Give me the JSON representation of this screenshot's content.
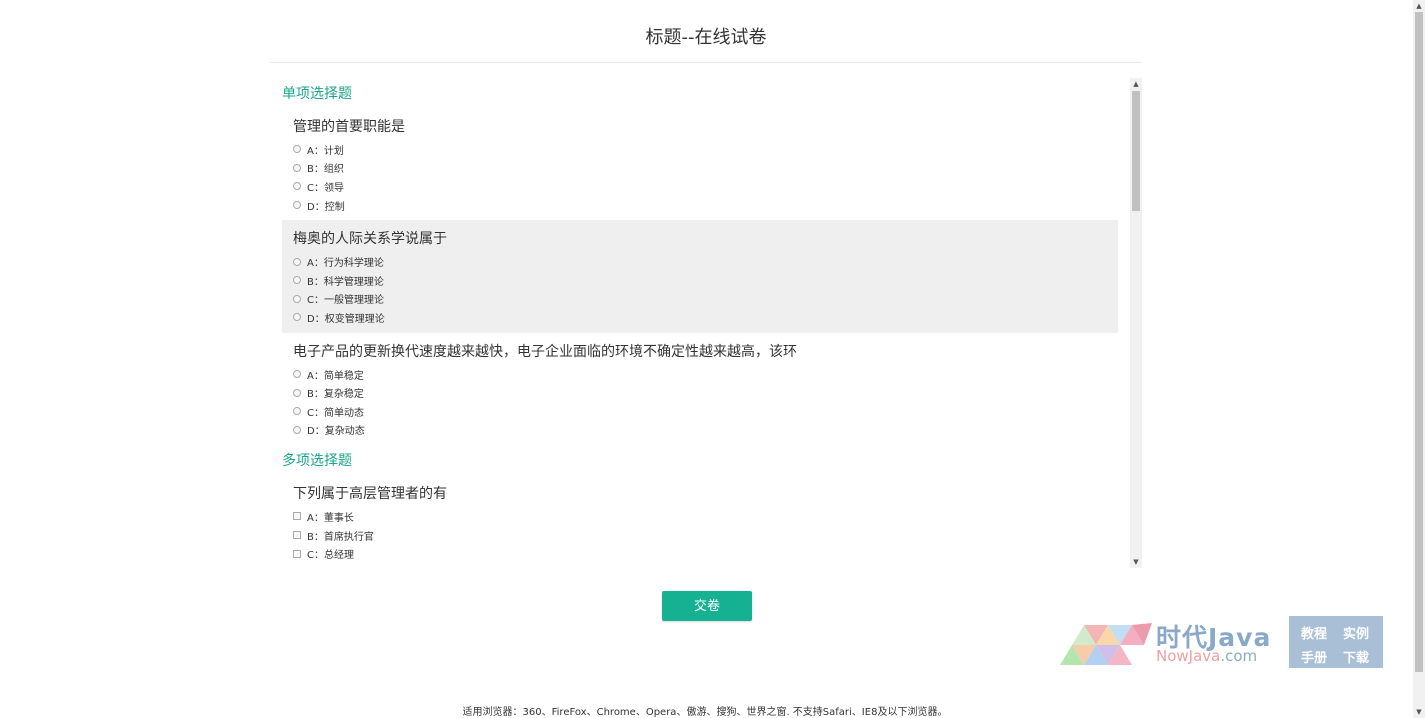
{
  "page": {
    "title": "标题--在线试卷"
  },
  "exam": {
    "single_section_title": "单项选择题",
    "multi_section_title": "多项选择题",
    "single_questions": [
      {
        "text": "管理的首要职能是",
        "options": [
          "A：计划",
          "B：组织",
          "C：领导",
          "D：控制"
        ]
      },
      {
        "text": "梅奥的人际关系学说属于",
        "options": [
          "A：行为科学理论",
          "B：科学管理理论",
          "C：一般管理理论",
          "D：权变管理理论"
        ]
      },
      {
        "text": "电子产品的更新换代速度越来越快，电子企业面临的环境不确定性越来越高，该环",
        "options": [
          "A：简单稳定",
          "B：复杂稳定",
          "C：简单动态",
          "D：复杂动态"
        ]
      }
    ],
    "multi_questions": [
      {
        "text": "下列属于高层管理者的有",
        "options": [
          "A：董事长",
          "B：首席执行官",
          "C：总经理"
        ]
      }
    ]
  },
  "actions": {
    "submit_label": "交卷"
  },
  "watermark": {
    "title": "时代Java",
    "subtitle_left": "NowJava",
    "subtitle_dot": ".com",
    "tag1": "教程",
    "tag2": "实例",
    "tag3": "手册",
    "tag4": "下载"
  },
  "footer": {
    "text": "适用浏览器：360、FireFox、Chrome、Opera、傲游、搜狗、世界之窗. 不支持Safari、IE8及以下浏览器。"
  },
  "colors": {
    "accent": "#1aa68c",
    "button": "#16b192",
    "highlight_row": "#efefef"
  }
}
